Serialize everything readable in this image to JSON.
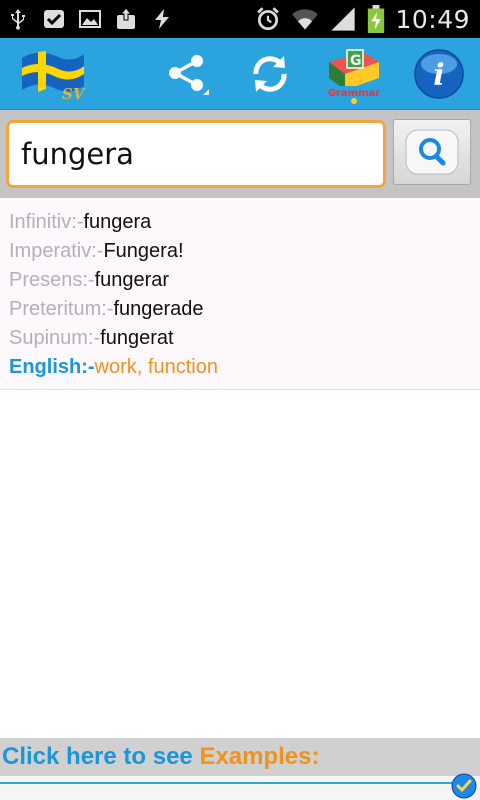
{
  "status_bar": {
    "time": "10:49",
    "icons": [
      "usb-icon",
      "check-badge-icon",
      "image-icon",
      "upload-icon",
      "sync-icon",
      "alarm-icon",
      "wifi-icon",
      "signal-icon",
      "battery-charging-icon"
    ]
  },
  "toolbar": {
    "flag_label": "SV",
    "grammar_label": "Grammar",
    "icons": [
      "sweden-flag-icon",
      "share-icon",
      "refresh-icon",
      "grammar-book-icon",
      "info-icon"
    ],
    "colors": {
      "background": "#2aa3de"
    }
  },
  "search": {
    "value": "fungera"
  },
  "conjugation": {
    "rows": [
      {
        "label": "Infinitiv:-",
        "value": "fungera"
      },
      {
        "label": "Imperativ:-",
        "value": "Fungera!"
      },
      {
        "label": "Presens:-",
        "value": "fungerar"
      },
      {
        "label": "Preteritum:-",
        "value": "fungerade"
      },
      {
        "label": "Supinum:-",
        "value": "fungerat"
      }
    ],
    "english": {
      "label": "English:-",
      "value": "work, function"
    }
  },
  "footer": {
    "prefix": "Click here to see ",
    "highlight": "Examples:"
  },
  "colors": {
    "accent_blue": "#1a97d8",
    "accent_orange": "#f0921e",
    "label_gray": "#b3b0b6"
  }
}
